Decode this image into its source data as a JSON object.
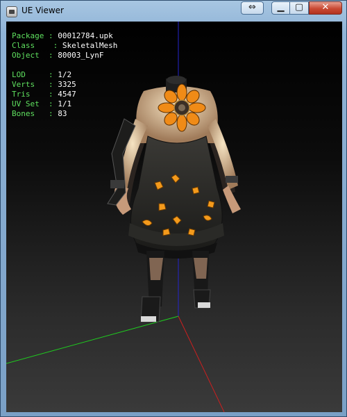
{
  "window": {
    "title": "UE Viewer"
  },
  "info": {
    "package": {
      "label": "Package",
      "value": "00012784.upk"
    },
    "class": {
      "label": "Class  ",
      "value": "SkeletalMesh"
    },
    "object": {
      "label": "Object ",
      "value": "80003_LynF"
    },
    "lod": {
      "label": "LOD    ",
      "value": "1/2"
    },
    "verts": {
      "label": "Verts  ",
      "value": "3325"
    },
    "tris": {
      "label": "Tris   ",
      "value": "4547"
    },
    "uvset": {
      "label": "UV Set ",
      "value": "1/1"
    },
    "bones": {
      "label": "Bones  ",
      "value": "83"
    }
  },
  "colors": {
    "label": "#5fe05f",
    "value": "#ffffff",
    "axis_x": "#cc1f1f",
    "axis_y": "#1fcc1f",
    "axis_z": "#2424cc",
    "accent": "#f39a1c"
  },
  "icons": {
    "app": "ue-viewer-icon",
    "swap": "swap-arrows-icon",
    "minimize": "minimize-icon",
    "maximize": "maximize-icon",
    "close": "close-icon"
  }
}
